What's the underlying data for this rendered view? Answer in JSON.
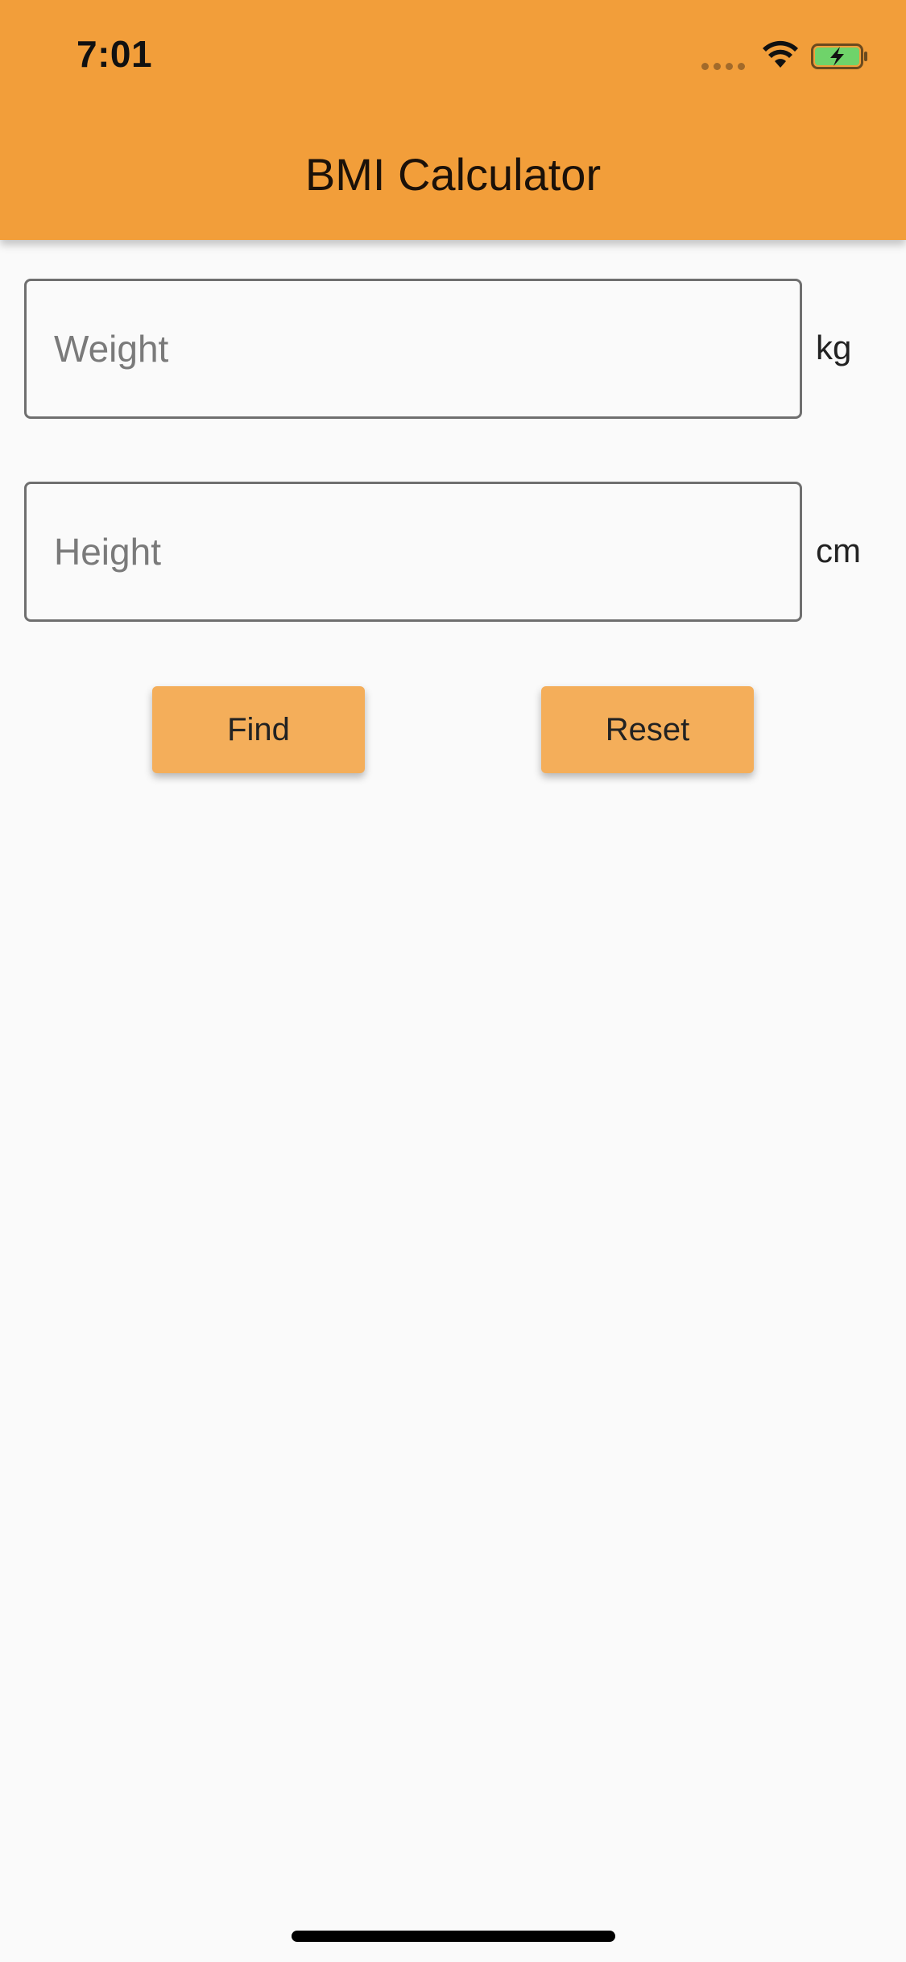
{
  "status_bar": {
    "time": "7:01",
    "icons": [
      "signal-icon",
      "wifi-icon",
      "battery-charging-icon"
    ]
  },
  "app_bar": {
    "title": "BMI Calculator",
    "color": "#f29e3a"
  },
  "form": {
    "weight": {
      "placeholder": "Weight",
      "value": "",
      "unit": "kg"
    },
    "height": {
      "placeholder": "Height",
      "value": "",
      "unit": "cm"
    }
  },
  "actions": {
    "find_label": "Find",
    "reset_label": "Reset",
    "button_color": "#f4ae5a"
  }
}
